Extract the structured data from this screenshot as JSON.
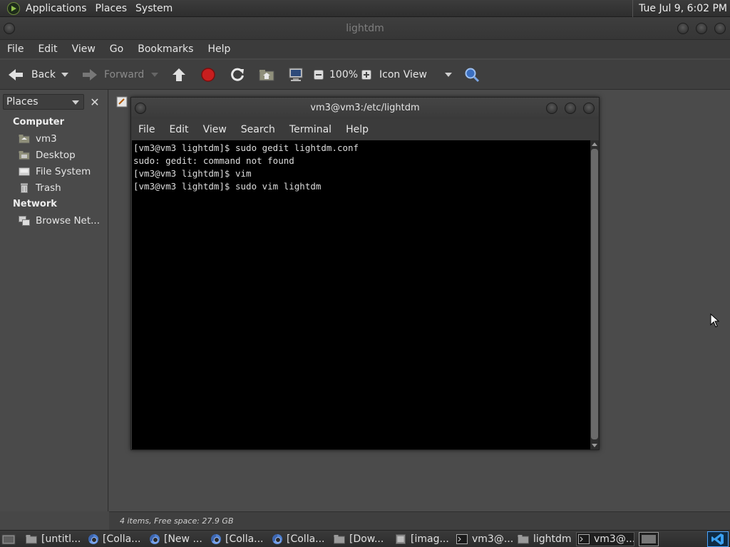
{
  "top_panel": {
    "menus": [
      "Applications",
      "Places",
      "System"
    ],
    "clock": "Tue Jul 9, 6:02 PM"
  },
  "file_manager": {
    "title": "lightdm",
    "menus": [
      "File",
      "Edit",
      "View",
      "Go",
      "Bookmarks",
      "Help"
    ],
    "toolbar": {
      "back": "Back",
      "forward": "Forward",
      "zoom": "100%",
      "view_mode": "Icon View"
    },
    "sidebar": {
      "selector": "Places",
      "sections": [
        {
          "header": "Computer",
          "items": [
            "vm3",
            "Desktop",
            "File System",
            "Trash"
          ]
        },
        {
          "header": "Network",
          "items": [
            "Browse Net..."
          ]
        }
      ]
    },
    "status": "4 items, Free space: 27.9 GB"
  },
  "terminal": {
    "title": "vm3@vm3:/etc/lightdm",
    "menus": [
      "File",
      "Edit",
      "View",
      "Search",
      "Terminal",
      "Help"
    ],
    "lines": [
      "[vm3@vm3 lightdm]$ sudo gedit lightdm.conf",
      "sudo: gedit: command not found",
      "[vm3@vm3 lightdm]$ vim",
      "[vm3@vm3 lightdm]$ sudo vim lightdm"
    ]
  },
  "taskbar": {
    "tasks": [
      "[untitl...",
      "[Colla...",
      "[New ...",
      "[Colla...",
      "[Colla...",
      "[Dow...",
      "[imag...",
      "vm3@...",
      "lightdm",
      "vm3@..."
    ]
  },
  "colors": {
    "panel": "#2e2e2e",
    "window": "#474747",
    "terminal_bg": "#000000",
    "stop": "#d02020",
    "accent_blue": "#4a86d8"
  }
}
